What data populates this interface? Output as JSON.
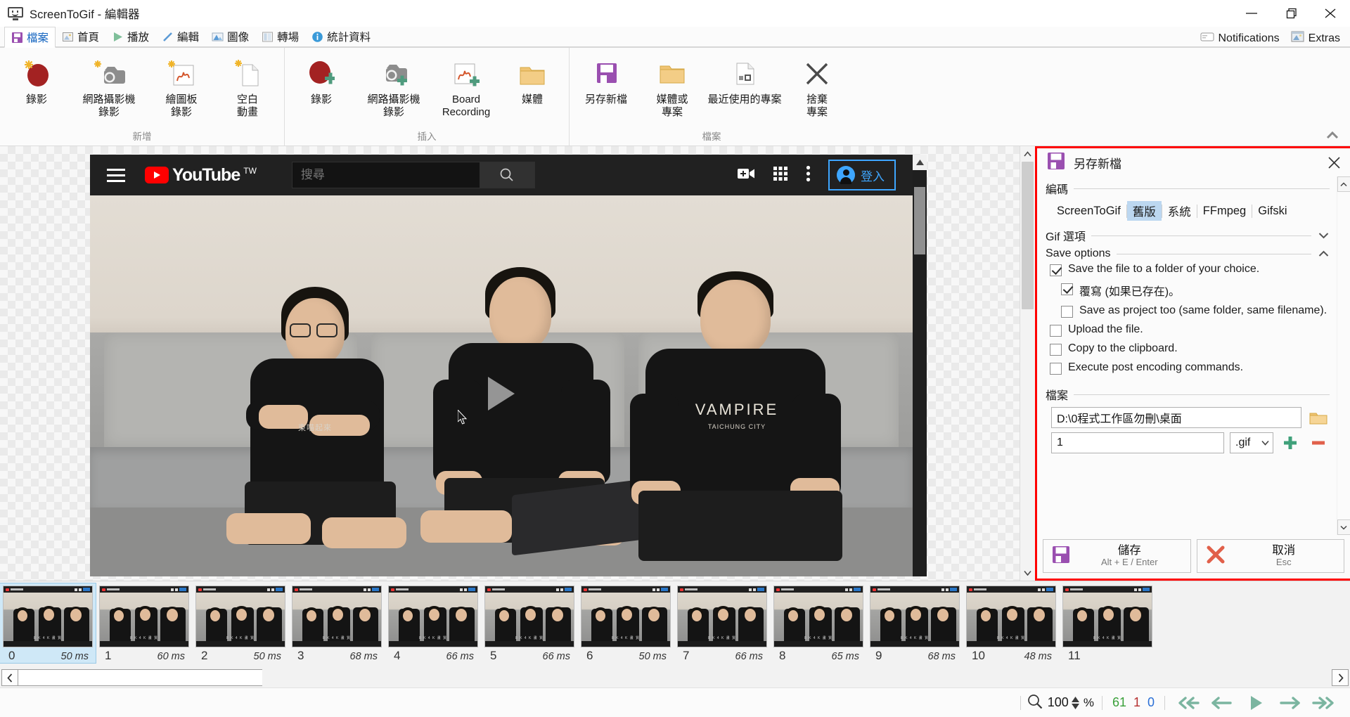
{
  "window": {
    "title": "ScreenToGif - 編輯器",
    "app_icon": "monitor-smiley-icon",
    "minimize": "—",
    "restore": "❐",
    "close": "✕"
  },
  "ribbon_tabs": {
    "items": [
      {
        "label": "檔案",
        "icon": "save-icon",
        "active": true
      },
      {
        "label": "首頁",
        "icon": "home-image-icon",
        "active": false
      },
      {
        "label": "播放",
        "icon": "play-icon",
        "active": false
      },
      {
        "label": "編輯",
        "icon": "pencil-icon",
        "active": false
      },
      {
        "label": "圖像",
        "icon": "image-icon",
        "active": false
      },
      {
        "label": "轉場",
        "icon": "transition-icon",
        "active": false
      },
      {
        "label": "統計資料",
        "icon": "info-icon",
        "active": false
      }
    ],
    "right_items": [
      {
        "label": "Notifications",
        "icon": "notification-icon"
      },
      {
        "label": "Extras",
        "icon": "extras-image-icon"
      }
    ]
  },
  "ribbon": {
    "collapse_icon": "chevron-up-icon",
    "groups": [
      {
        "label": "新增",
        "buttons": [
          {
            "label": "錄影",
            "icon": "record-new-icon"
          },
          {
            "label": "網路攝影機\n錄影",
            "icon": "webcam-new-icon"
          },
          {
            "label": "繪圖板\n錄影",
            "icon": "board-new-icon"
          },
          {
            "label": "空白\n動畫",
            "icon": "blank-new-icon"
          }
        ]
      },
      {
        "label": "插入",
        "buttons": [
          {
            "label": "錄影",
            "icon": "record-insert-icon"
          },
          {
            "label": "網路攝影機\n錄影",
            "icon": "webcam-insert-icon"
          },
          {
            "label": "Board\nRecording",
            "icon": "board-insert-icon"
          },
          {
            "label": "媒體",
            "icon": "folder-media-icon"
          }
        ]
      },
      {
        "label": "檔案",
        "buttons": [
          {
            "label": "另存新檔",
            "icon": "save-as-icon"
          },
          {
            "label": "媒體或\n專案",
            "icon": "folder-open-icon"
          },
          {
            "label": "最近使用的專案",
            "icon": "recent-project-icon"
          },
          {
            "label": "捨棄\n專案",
            "icon": "discard-x-icon"
          }
        ]
      }
    ]
  },
  "preview": {
    "youtube": {
      "logo_text": "YouTube",
      "region_sup": "TW",
      "search_placeholder": "搜尋",
      "search_value": "",
      "search_icon": "magnifier-icon",
      "menu_icon": "hamburger-icon",
      "create_icon": "video-plus-icon",
      "apps_icon": "grid-apps-icon",
      "more_icon": "kebab-menu-icon",
      "signin_label": "登入",
      "signin_icon": "account-circle-icon"
    },
    "play_overlay_icon": "play-triangle-icon",
    "cursor_icon": "mouse-cursor-icon"
  },
  "save_panel": {
    "title": "另存新檔",
    "title_icon": "floppy-save-icon",
    "close_icon": "close-x-icon",
    "sections": {
      "encoder": {
        "label": "編碼"
      },
      "gif_options": {
        "label": "Gif 選項",
        "chevron": "chevron-down-icon",
        "expanded": false
      },
      "save_options": {
        "label": "Save options",
        "chevron": "chevron-up-icon",
        "expanded": true
      },
      "file": {
        "label": "檔案"
      }
    },
    "encoders": [
      {
        "label": "ScreenToGif",
        "selected": false
      },
      {
        "label": "舊版",
        "selected": true
      },
      {
        "label": "系統",
        "selected": false
      },
      {
        "label": "FFmpeg",
        "selected": false
      },
      {
        "label": "Gifski",
        "selected": false
      }
    ],
    "options": [
      {
        "label": "Save the file to a folder of your choice.",
        "checked": true,
        "indent": false
      },
      {
        "label": "覆寫 (如果已存在)。",
        "checked": true,
        "indent": true
      },
      {
        "label": "Save as project too (same folder, same filename).",
        "checked": false,
        "indent": true
      },
      {
        "label": "Upload the file.",
        "checked": false,
        "indent": false
      },
      {
        "label": "Copy to the clipboard.",
        "checked": false,
        "indent": false
      },
      {
        "label": "Execute post encoding commands.",
        "checked": false,
        "indent": false
      }
    ],
    "file": {
      "path_value": "D:\\0程式工作區勿刪\\桌面",
      "browse_icon": "folder-browse-icon",
      "name_value": "1",
      "extension_value": ".gif",
      "extension_chevron": "chevron-down-icon",
      "add_icon": "plus-icon",
      "remove_icon": "minus-icon",
      "add_color": "#3fa07a",
      "remove_color": "#e1604a"
    },
    "buttons": {
      "save": {
        "label": "儲存",
        "shortcut": "Alt + E / Enter",
        "icon": "floppy-save-icon"
      },
      "cancel": {
        "label": "取消",
        "shortcut": "Esc",
        "icon": "red-x-icon"
      }
    },
    "highlight_color": "#ff0000"
  },
  "filmstrip": {
    "frames": [
      {
        "index": "0",
        "duration": "50 ms",
        "selected": true
      },
      {
        "index": "1",
        "duration": "60 ms",
        "selected": false
      },
      {
        "index": "2",
        "duration": "50 ms",
        "selected": false
      },
      {
        "index": "3",
        "duration": "68 ms",
        "selected": false
      },
      {
        "index": "4",
        "duration": "66 ms",
        "selected": false
      },
      {
        "index": "5",
        "duration": "66 ms",
        "selected": false
      },
      {
        "index": "6",
        "duration": "50 ms",
        "selected": false
      },
      {
        "index": "7",
        "duration": "66 ms",
        "selected": false
      },
      {
        "index": "8",
        "duration": "65 ms",
        "selected": false
      },
      {
        "index": "9",
        "duration": "68 ms",
        "selected": false
      },
      {
        "index": "10",
        "duration": "48 ms",
        "selected": false
      },
      {
        "index": "11",
        "duration": "",
        "selected": false
      }
    ],
    "scroll_left_icon": "chevron-left-icon",
    "scroll_right_icon": "chevron-right-icon"
  },
  "statusbar": {
    "zoom_icon": "magnifier-icon",
    "zoom_value": "100",
    "zoom_spinner_icon": "up-down-spinner-icon",
    "percent_symbol": "%",
    "total_frames": "61",
    "selected_count": "1",
    "current_index": "0",
    "total_color": "#3aa03a",
    "selected_color": "#b63030",
    "index_color": "#2a6fd6",
    "nav": [
      {
        "name": "first-frame-button",
        "icon": "double-arrow-left-icon"
      },
      {
        "name": "previous-frame-button",
        "icon": "arrow-left-icon"
      },
      {
        "name": "play-button",
        "icon": "play-triangle-icon"
      },
      {
        "name": "next-frame-button",
        "icon": "arrow-right-icon"
      },
      {
        "name": "last-frame-button",
        "icon": "double-arrow-right-icon"
      }
    ],
    "accent_color": "#7bb5a0"
  }
}
